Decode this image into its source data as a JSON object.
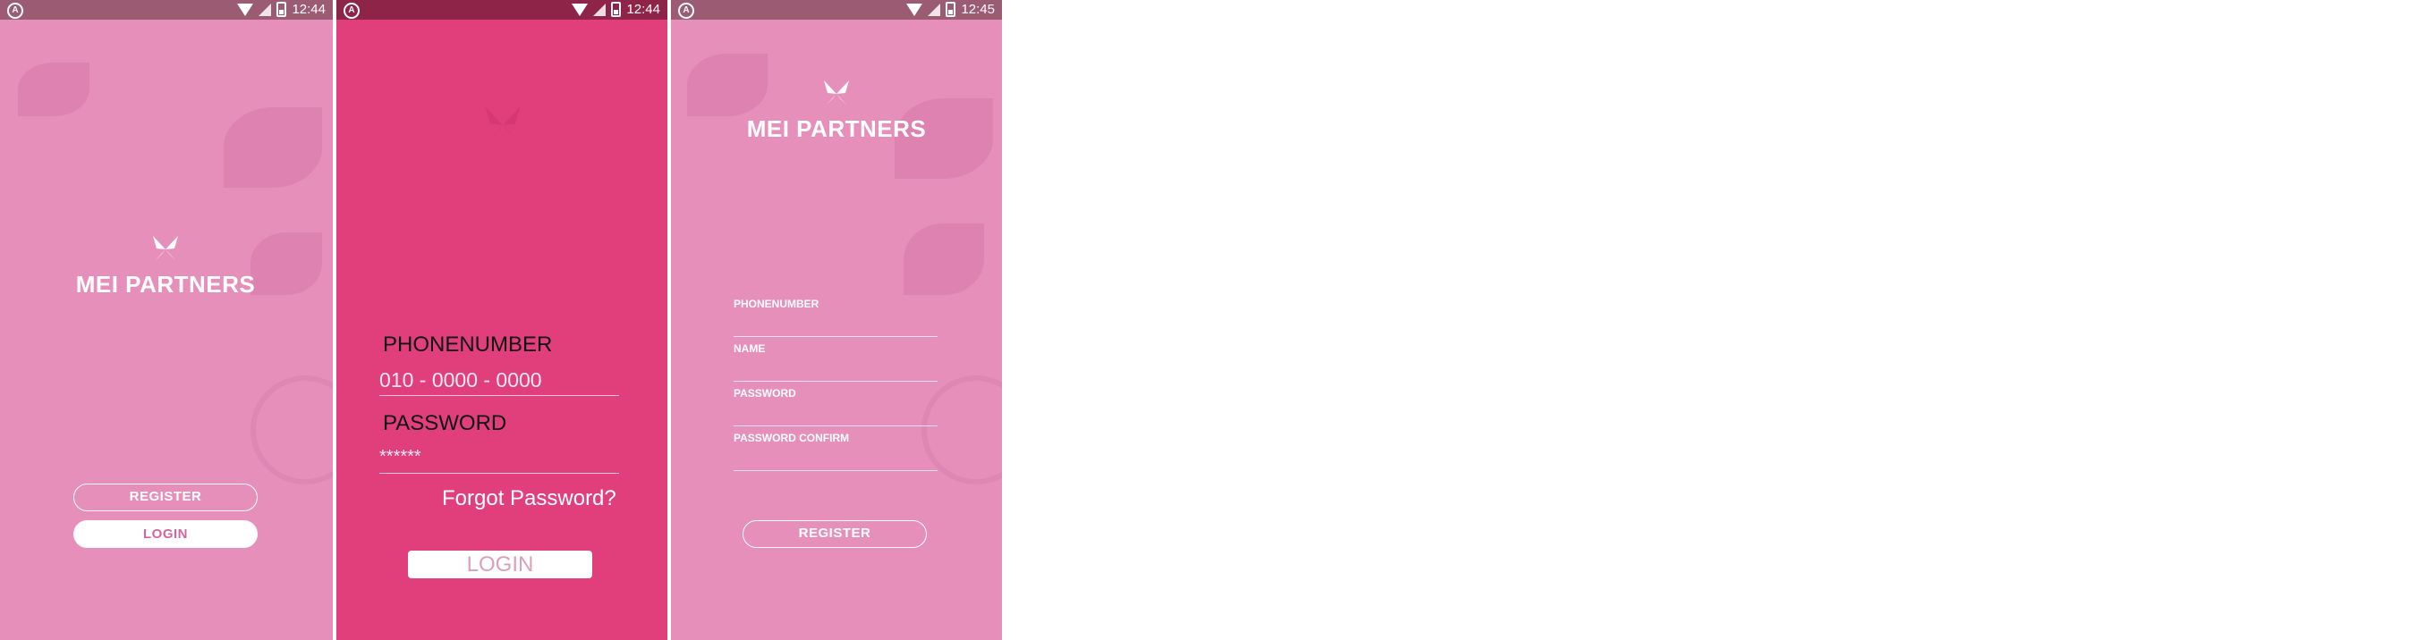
{
  "screens": [
    {
      "status_time": "12:44",
      "logo_text": "MEI PARTNERS",
      "buttons": {
        "register": "REGISTER",
        "login": "LOGIN"
      }
    },
    {
      "status_time": "12:44",
      "phone_label": "PHONENUMBER",
      "phone_value": "010 - 0000 - 0000",
      "password_label": "PASSWORD",
      "password_value": "******",
      "forgot": "Forgot Password?",
      "login": "LOGIN"
    },
    {
      "status_time": "12:45",
      "logo_text": "MEI PARTNERS",
      "fields": [
        "PHONENUMBER",
        "NAME",
        "PASSWORD",
        "PASSWORD CONFIRM"
      ],
      "register": "REGISTER"
    }
  ],
  "colors": {
    "screen_pink": "#e68fbb",
    "screen_magenta": "#e03f7b",
    "button_text_pink": "#d3669a"
  },
  "icons": [
    "android-icon",
    "wifi-icon",
    "signal-icon",
    "battery-icon",
    "butterfly-logo-icon"
  ]
}
